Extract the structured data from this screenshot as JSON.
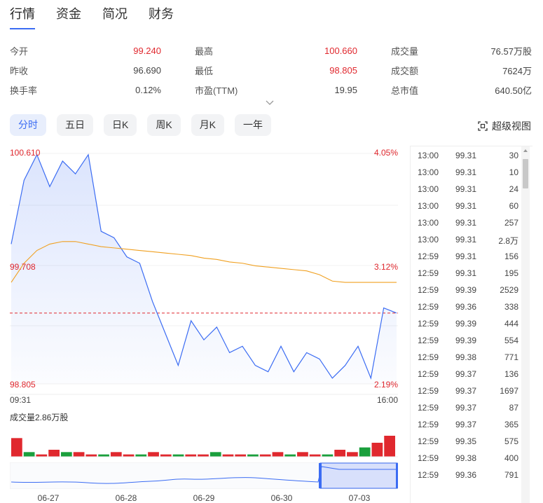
{
  "tabs": [
    "行情",
    "资金",
    "简况",
    "财务"
  ],
  "stats": [
    [
      {
        "label": "今开",
        "value": "99.240",
        "color": "red"
      },
      {
        "label": "最高",
        "value": "100.660",
        "color": "red"
      },
      {
        "label": "成交量",
        "value": "76.57万股",
        "color": "dark"
      }
    ],
    [
      {
        "label": "昨收",
        "value": "96.690",
        "color": "dark"
      },
      {
        "label": "最低",
        "value": "98.805",
        "color": "red"
      },
      {
        "label": "成交额",
        "value": "7624万",
        "color": "dark"
      }
    ],
    [
      {
        "label": "换手率",
        "value": "0.12%",
        "color": "dark"
      },
      {
        "label": "市盈(TTM)",
        "value": "19.95",
        "color": "dark"
      },
      {
        "label": "总市值",
        "value": "640.50亿",
        "color": "dark"
      }
    ]
  ],
  "periods": [
    "分时",
    "五日",
    "日K",
    "周K",
    "月K",
    "一年"
  ],
  "active_period": 0,
  "super_view_label": "超级视图",
  "chart_labels": {
    "price_high": "100.610",
    "price_mid": "99.708",
    "price_low": "98.805",
    "pct_high": "4.05%",
    "pct_mid": "3.12%",
    "pct_low": "2.19%",
    "time_start": "09:31",
    "time_end": "16:00"
  },
  "volume_label": "成交量2.86万股",
  "nav_dates": [
    "06-27",
    "06-28",
    "06-29",
    "06-30",
    "07-03"
  ],
  "colors": {
    "accent": "#3b6cf3",
    "up": "#e0282e",
    "down": "#1a9f3c",
    "avg_line": "#f0a020"
  },
  "chart_data": {
    "type": "line",
    "series": [
      {
        "values": [
          99.9,
          100.4,
          100.6,
          100.35,
          100.55,
          100.45,
          100.6,
          100.0,
          99.95,
          99.8,
          99.75,
          99.45,
          99.2,
          98.95,
          99.3,
          99.15,
          99.25,
          99.05,
          99.1,
          98.95,
          98.9,
          99.1,
          98.9,
          99.05,
          99.0,
          98.85,
          98.95,
          99.1,
          98.85,
          99.4,
          99.36
        ]
      },
      {
        "values": [
          99.6,
          99.75,
          99.85,
          99.9,
          99.92,
          99.92,
          99.9,
          99.88,
          99.87,
          99.86,
          99.85,
          99.84,
          99.83,
          99.82,
          99.81,
          99.79,
          99.78,
          99.76,
          99.75,
          99.73,
          99.72,
          99.71,
          99.7,
          99.69,
          99.66,
          99.61,
          99.6,
          99.6,
          99.6,
          99.6,
          99.6
        ]
      }
    ],
    "ylim": [
      98.805,
      100.61
    ],
    "reference": 99.36,
    "volume": [
      8,
      2,
      1,
      3,
      2,
      2,
      1,
      1,
      2,
      1,
      1,
      2,
      1,
      1,
      1,
      1,
      2,
      1,
      1,
      1,
      1,
      2,
      1,
      2,
      1,
      1,
      3,
      2,
      4,
      6,
      9
    ]
  },
  "ticks": [
    {
      "time": "13:00",
      "price": "99.31",
      "vol": "30"
    },
    {
      "time": "13:00",
      "price": "99.31",
      "vol": "10"
    },
    {
      "time": "13:00",
      "price": "99.31",
      "vol": "24"
    },
    {
      "time": "13:00",
      "price": "99.31",
      "vol": "60"
    },
    {
      "time": "13:00",
      "price": "99.31",
      "vol": "257"
    },
    {
      "time": "13:00",
      "price": "99.31",
      "vol": "2.8万"
    },
    {
      "time": "12:59",
      "price": "99.31",
      "vol": "156"
    },
    {
      "time": "12:59",
      "price": "99.31",
      "vol": "195"
    },
    {
      "time": "12:59",
      "price": "99.39",
      "vol": "2529"
    },
    {
      "time": "12:59",
      "price": "99.36",
      "vol": "338"
    },
    {
      "time": "12:59",
      "price": "99.39",
      "vol": "444"
    },
    {
      "time": "12:59",
      "price": "99.39",
      "vol": "554"
    },
    {
      "time": "12:59",
      "price": "99.38",
      "vol": "771"
    },
    {
      "time": "12:59",
      "price": "99.37",
      "vol": "136"
    },
    {
      "time": "12:59",
      "price": "99.37",
      "vol": "1697"
    },
    {
      "time": "12:59",
      "price": "99.37",
      "vol": "87"
    },
    {
      "time": "12:59",
      "price": "99.37",
      "vol": "365"
    },
    {
      "time": "12:59",
      "price": "99.35",
      "vol": "575"
    },
    {
      "time": "12:59",
      "price": "99.38",
      "vol": "400"
    },
    {
      "time": "12:59",
      "price": "99.36",
      "vol": "791"
    }
  ]
}
